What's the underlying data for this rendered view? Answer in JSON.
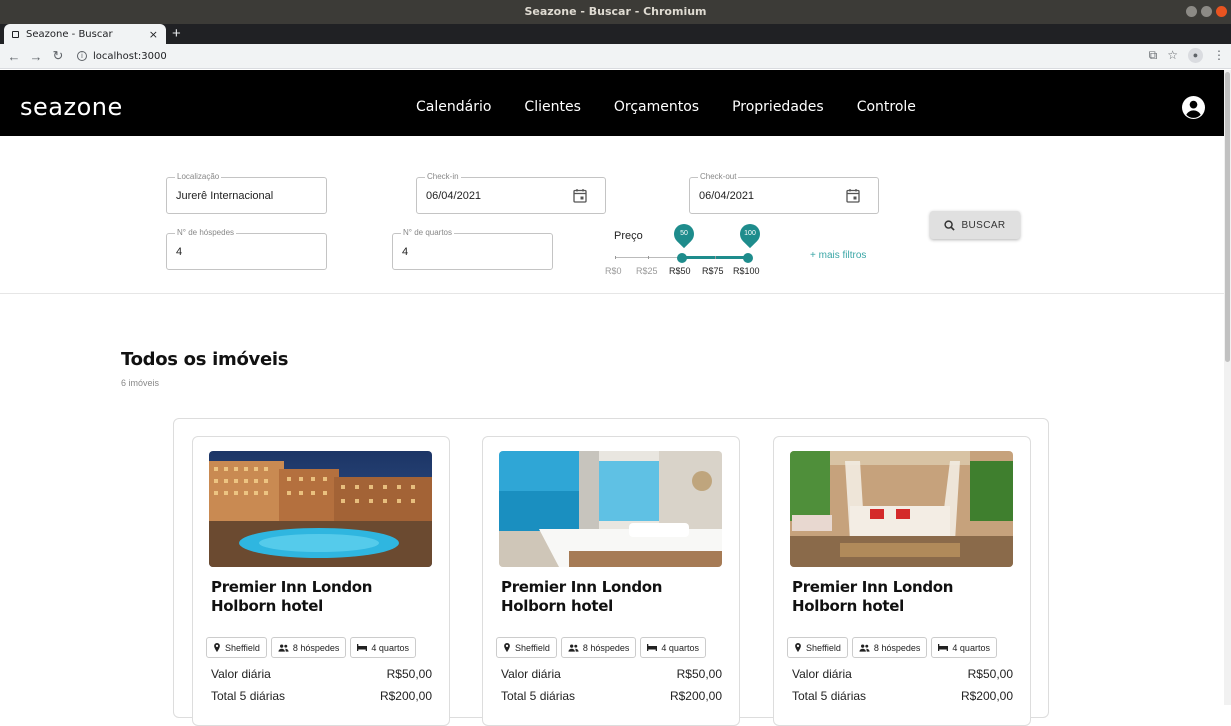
{
  "window": {
    "title": "Seazone - Buscar - Chromium"
  },
  "browser": {
    "tab_title": "Seazone - Buscar",
    "tab_close": "×",
    "new_tab": "+",
    "url": "localhost:3000"
  },
  "header": {
    "logo": "seazone",
    "nav": [
      "Calendário",
      "Clientes",
      "Orçamentos",
      "Propriedades",
      "Controle"
    ]
  },
  "search": {
    "location": {
      "label": "Localização",
      "value": "Jurerê Internacional"
    },
    "checkin": {
      "label": "Check-in",
      "value": "06/04/2021"
    },
    "checkout": {
      "label": "Check-out",
      "value": "06/04/2021"
    },
    "guests": {
      "label": "N° de hóspedes",
      "value": "4"
    },
    "rooms": {
      "label": "N° de quartos",
      "value": "4"
    },
    "price": {
      "label": "Preço",
      "min_value": "50",
      "max_value": "100",
      "ticks": [
        "R$0",
        "R$25",
        "R$50",
        "R$75",
        "R$100"
      ]
    },
    "more_filters": "+ mais filtros",
    "button": "BUSCAR"
  },
  "results": {
    "title": "Todos os imóveis",
    "count": "6 imóveis",
    "cards": [
      {
        "title": "Premier Inn London Holborn hotel",
        "city": "Sheffield",
        "guests": "8 hóspedes",
        "rooms": "4 quartos",
        "daily_label": "Valor diária",
        "daily_value": "R$50,00",
        "total_label": "Total 5 diárias",
        "total_value": "R$200,00"
      },
      {
        "title": "Premier Inn London Holborn hotel",
        "city": "Sheffield",
        "guests": "8 hóspedes",
        "rooms": "4 quartos",
        "daily_label": "Valor diária",
        "daily_value": "R$50,00",
        "total_label": "Total 5 diárias",
        "total_value": "R$200,00"
      },
      {
        "title": "Premier Inn London Holborn hotel",
        "city": "Sheffield",
        "guests": "8 hóspedes",
        "rooms": "4 quartos",
        "daily_label": "Valor diária",
        "daily_value": "R$50,00",
        "total_label": "Total 5 diárias",
        "total_value": "R$200,00"
      }
    ]
  },
  "colors": {
    "accent": "#1e8c8c",
    "header_bg": "#000000",
    "link": "#3aa6a6"
  }
}
